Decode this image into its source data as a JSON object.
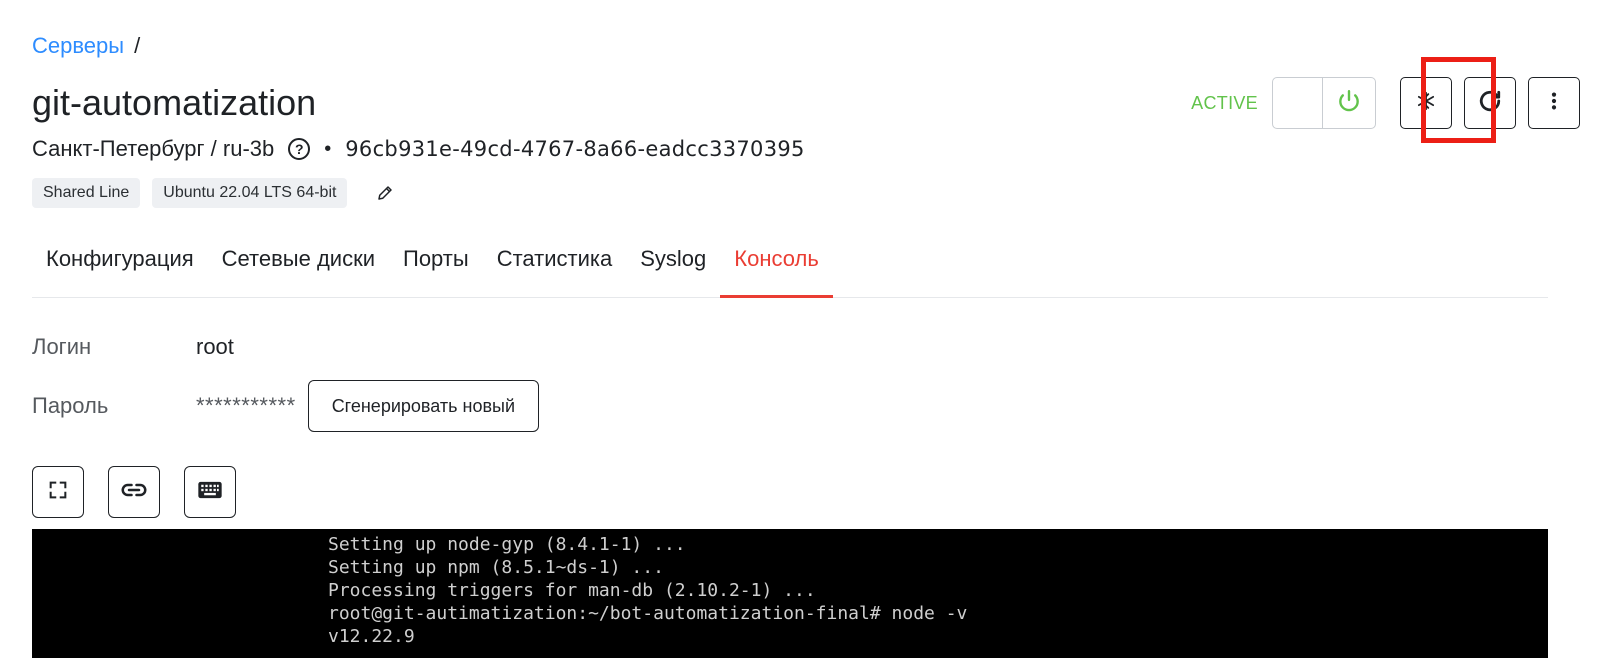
{
  "breadcrumb": {
    "root": "Серверы",
    "separator": "/"
  },
  "server": {
    "name": "git-automatization",
    "location": "Санкт-Петербург / ru-3b",
    "help_glyph": "?",
    "dot": "•",
    "uuid": "96cb931e-49cd-4767-8a66-eadcc3370395",
    "tags": [
      "Shared Line",
      "Ubuntu 22.04 LTS 64-bit"
    ],
    "status": "ACTIVE"
  },
  "tabs": [
    {
      "label": "Конфигурация",
      "active": false
    },
    {
      "label": "Сетевые диски",
      "active": false
    },
    {
      "label": "Порты",
      "active": false
    },
    {
      "label": "Статистика",
      "active": false
    },
    {
      "label": "Syslog",
      "active": false
    },
    {
      "label": "Консоль",
      "active": true
    }
  ],
  "credentials": {
    "login_label": "Логин",
    "login_value": "root",
    "password_label": "Пароль",
    "password_value": "***********",
    "generate_label": "Сгенерировать новый"
  },
  "console": {
    "lines": [
      "Setting up node-gyp (8.4.1-1) ...",
      "Setting up npm (8.5.1~ds-1) ...",
      "Processing triggers for man-db (2.10.2-1) ...",
      "root@git-autimatization:~/bot-automatization-final# node -v",
      "v12.22.9"
    ]
  },
  "icons": {
    "power": "power-icon",
    "snowflake": "snowflake-icon",
    "reboot": "reboot-icon",
    "more": "more-vertical-icon",
    "fullscreen": "fullscreen-icon",
    "link": "link-icon",
    "keyboard": "keyboard-icon",
    "edit": "pencil-icon",
    "help": "help-circle-icon"
  },
  "colors": {
    "accent_link": "#2d8cff",
    "active_tab": "#ea3d33",
    "status_active": "#62c34b",
    "highlight": "#ec1f16"
  }
}
